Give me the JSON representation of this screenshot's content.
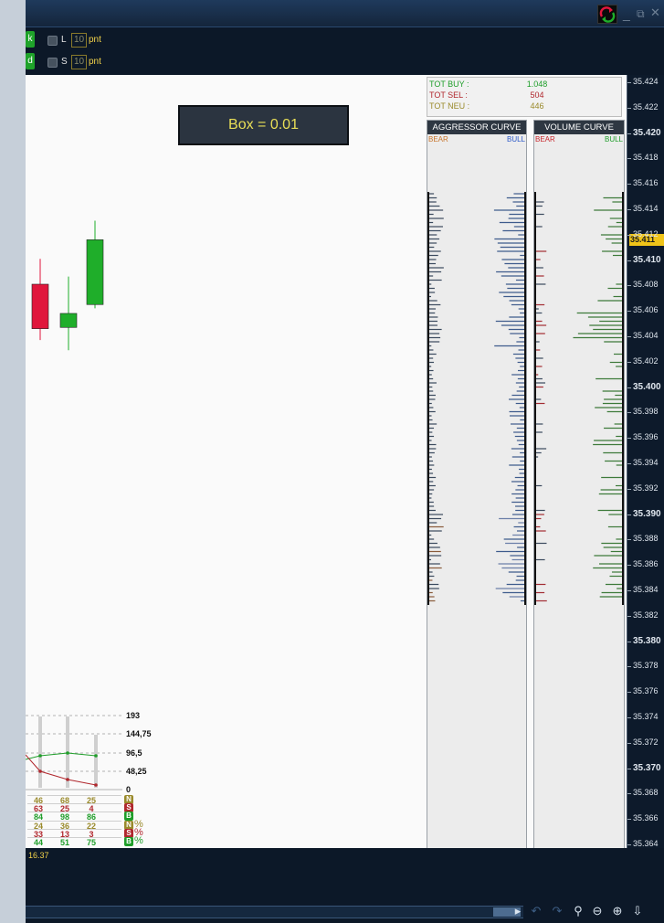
{
  "toolbar": {
    "btn_top": "k",
    "btn_bottom": "d",
    "long_label": "L",
    "long_value": "10",
    "short_label": "S",
    "short_value": "10",
    "unit": "pnt"
  },
  "chart": {
    "box_label": "Box = 0.01",
    "candles": [
      {
        "open": 35.4046,
        "close": 35.4081,
        "high": 35.4101,
        "low": 35.4037,
        "color": "#e0163c"
      },
      {
        "open": 35.4047,
        "close": 35.4058,
        "high": 35.4087,
        "low": 35.4029,
        "color": "#1fae2a"
      },
      {
        "open": 35.4065,
        "close": 35.4116,
        "high": 35.4131,
        "low": 35.4062,
        "color": "#1fae2a"
      }
    ]
  },
  "totals": {
    "buy_label": "TOT BUY :",
    "buy_value": "1.048",
    "sel_label": "TOT SEL :",
    "sel_value": "504",
    "neu_label": "TOT NEU :",
    "neu_value": "446",
    "colors": {
      "buy": "#1f9e2a",
      "sel": "#b0272d",
      "neu": "#9a8a2b"
    }
  },
  "aggressor_curve": {
    "title": "AGGRESSOR CURVE",
    "bear": "BEAR",
    "bull": "BULL"
  },
  "volume_curve": {
    "title": "VOLUME CURVE",
    "bear": "BEAR",
    "bull": "BULL"
  },
  "price_axis": {
    "labels": [
      "35.424",
      "35.422",
      "35.420",
      "35.418",
      "35.416",
      "35.414",
      "35.412",
      "35.410",
      "35.408",
      "35.406",
      "35.404",
      "35.402",
      "35.400",
      "35.398",
      "35.396",
      "35.394",
      "35.392",
      "35.390",
      "35.388",
      "35.386",
      "35.384",
      "35.382",
      "35.380",
      "35.378",
      "35.376",
      "35.374",
      "35.372",
      "35.370",
      "35.368",
      "35.366",
      "35.364"
    ],
    "bold": [
      "35.420",
      "35.410",
      "35.400",
      "35.390",
      "35.380",
      "35.370"
    ],
    "current": "35.411"
  },
  "stats": {
    "scale": [
      "193",
      "144,75",
      "96,5",
      "48,25",
      "0"
    ],
    "rows": [
      {
        "values": [
          "46",
          "68",
          "25"
        ],
        "badge": "N",
        "pct": false,
        "color": "#9a8a2b"
      },
      {
        "values": [
          "63",
          "25",
          "4"
        ],
        "badge": "S",
        "pct": false,
        "color": "#b0272d"
      },
      {
        "values": [
          "84",
          "98",
          "86"
        ],
        "badge": "B",
        "pct": false,
        "color": "#1f9e2a"
      },
      {
        "values": [
          "24",
          "36",
          "22"
        ],
        "badge": "N",
        "pct": true,
        "color": "#9a8a2b"
      },
      {
        "values": [
          "33",
          "13",
          "3"
        ],
        "badge": "S",
        "pct": true,
        "color": "#b0272d"
      },
      {
        "values": [
          "44",
          "51",
          "75"
        ],
        "badge": "B",
        "pct": true,
        "color": "#1f9e2a"
      }
    ],
    "pct_symbol": "%"
  },
  "status": {
    "value": "16.37"
  },
  "icons": [
    "refresh-icon",
    "minimize-icon",
    "restore-icon",
    "close-icon",
    "scroll-right-icon",
    "undo-icon",
    "redo-icon",
    "zoom-fit-icon",
    "zoom-out-icon",
    "zoom-in-icon",
    "download-icon"
  ]
}
